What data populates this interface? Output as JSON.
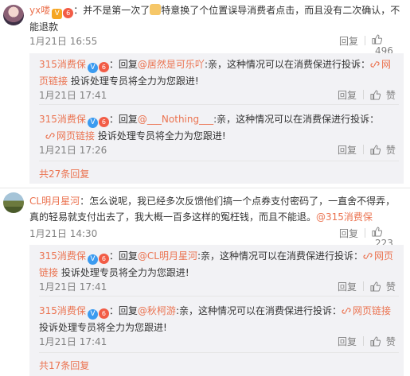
{
  "c1": {
    "user": "yx喽",
    "text_a": "：并不是第一次了",
    "text_b": "特意换了个位置误导消费者点击，而且没有二次确认，不能退款",
    "time": "1月21日 16:55",
    "reply_label": "回复",
    "likes": "496",
    "replies": [
      {
        "user": "315消费保",
        "prefix": "：回复",
        "mention": "@居然是可乐吖",
        "text": ":亲，这种情况可以在消费保进行投诉：",
        "link_label": "网页链接",
        "text2": " 投诉处理专员将全力为您跟进!",
        "time": "1月21日 17:41",
        "reply_label": "回复",
        "like_label": "赞"
      },
      {
        "user": "315消费保",
        "prefix": "：回复",
        "mention": "@___Nothing___",
        "text": ":亲，这种情况可以在消费保进行投诉：",
        "link_label": "网页链接",
        "text2": " 投诉处理专员将全力为您跟进!",
        "time": "1月21日 17:26",
        "reply_label": "回复",
        "like_label": "赞"
      }
    ],
    "more": "共27条回复"
  },
  "c2": {
    "user": "CL明月星河",
    "text": "：怎么说呢，我已经多次反馈他们搞一个点券支付密码了，一直舍不得弄，真的轻易就支付出去了，我大概一百多这样的冤枉钱，而且不能退。",
    "mention": "@315消费保",
    "time": "1月21日 14:30",
    "reply_label": "回复",
    "likes": "223",
    "replies": [
      {
        "user": "315消费保",
        "prefix": "：回复",
        "mention": "@CL明月星河",
        "text": ":亲，这种情况可以在消费保进行投诉：",
        "link_label": "网页链接",
        "text2": " 投诉处理专员将全力为您跟进!",
        "time": "1月21日 17:41",
        "reply_label": "回复",
        "like_label": "赞"
      },
      {
        "user": "315消费保",
        "prefix": "：回复",
        "mention": "@秋柯游",
        "text": ":亲，这种情况可以在消费保进行投诉：",
        "link_label": "网页链接",
        "text2": " 投诉处理专员将全力为您跟进!",
        "time": "1月21日 17:41",
        "reply_label": "回复",
        "like_label": "赞"
      }
    ],
    "more": "共17条回复"
  },
  "colors": {
    "link": "#eb7350",
    "meta": "#808080",
    "reply_bg": "#f2f2f5"
  }
}
